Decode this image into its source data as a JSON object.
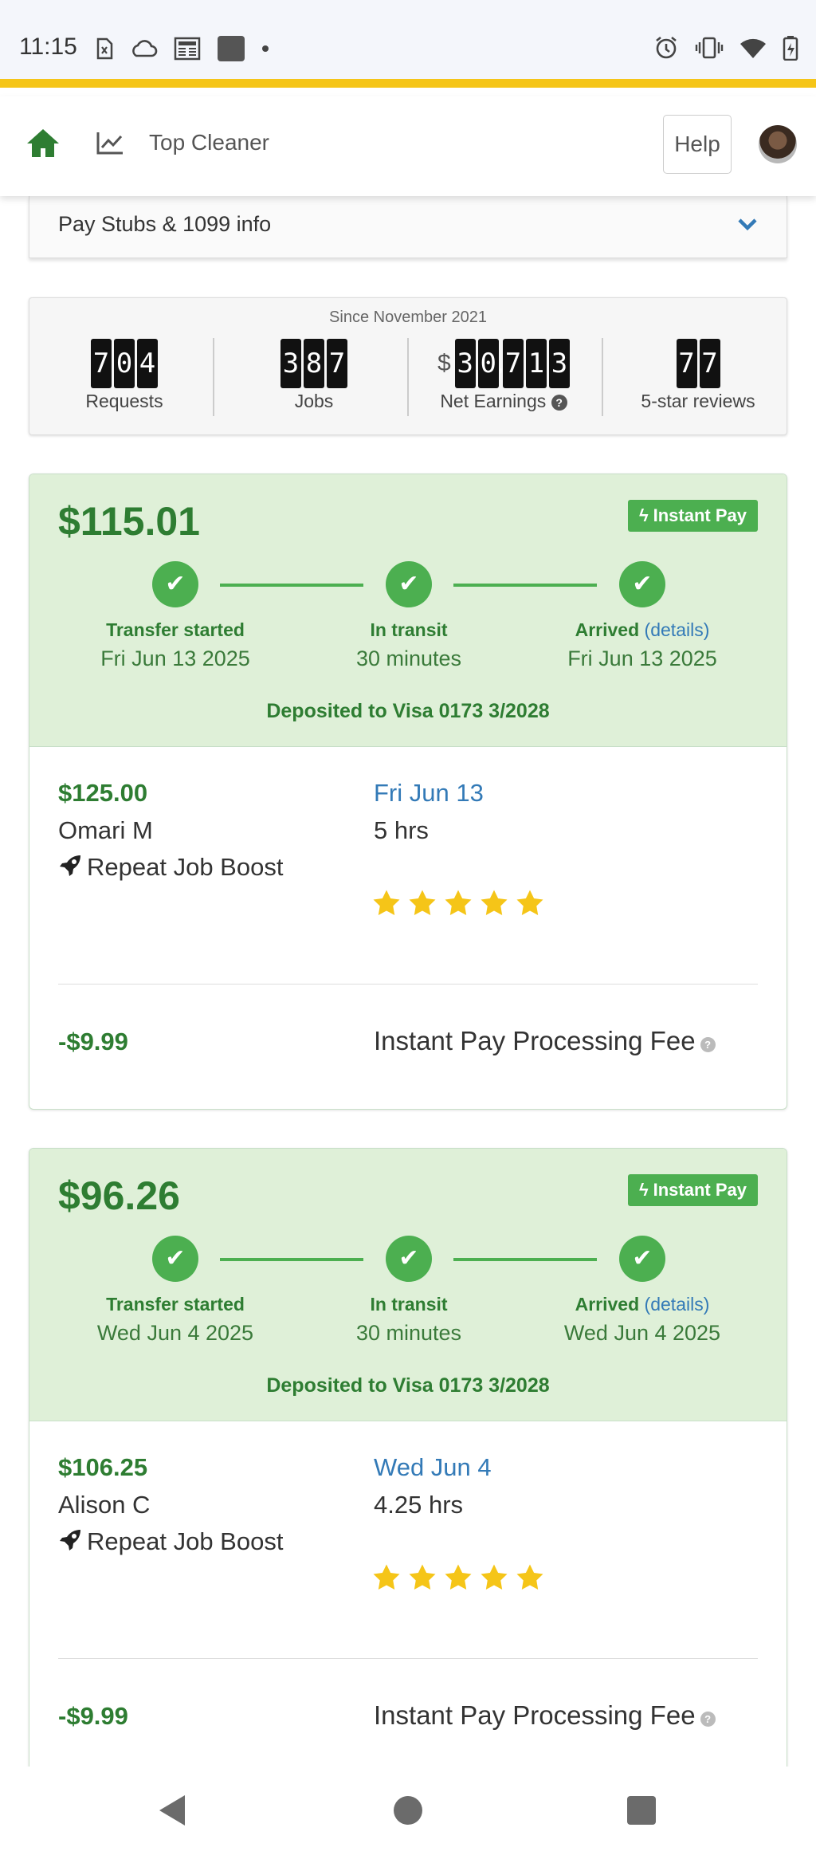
{
  "status_bar": {
    "time": "11:15",
    "left_icons": [
      "sim-icon",
      "cloud-icon",
      "newspaper-icon",
      "app-square-icon",
      "dot-icon"
    ],
    "right_icons": [
      "alarm-icon",
      "vibrate-icon",
      "wifi-icon",
      "battery-icon"
    ]
  },
  "header": {
    "title": "Top Cleaner",
    "help_label": "Help",
    "accent_color": "#f5c518",
    "home_color": "#2e7d32"
  },
  "pay_stubs": {
    "label": "Pay Stubs & 1099 info"
  },
  "stats": {
    "since": "Since November 2021",
    "items": [
      {
        "digits": [
          "7",
          "0",
          "4"
        ],
        "label": "Requests"
      },
      {
        "digits": [
          "3",
          "8",
          "7"
        ],
        "label": "Jobs"
      },
      {
        "prefix": "$",
        "digits": [
          "3",
          "0",
          ",",
          "7",
          "1",
          "3"
        ],
        "label": "Net Earnings"
      },
      {
        "digits": [
          "7",
          "7"
        ],
        "label": "5-star reviews"
      }
    ]
  },
  "payouts": [
    {
      "amount": "$115.01",
      "badge": "Instant Pay",
      "steps": [
        {
          "label": "Transfer started",
          "sub": "Fri Jun 13 2025"
        },
        {
          "label": "In transit",
          "sub": "30 minutes"
        },
        {
          "label": "Arrived",
          "link": "details",
          "sub": "Fri Jun 13 2025"
        }
      ],
      "deposit": "Deposited to Visa 0173 3/2028",
      "job": {
        "amount": "$125.00",
        "client": "Omari M",
        "boost": "Repeat Job Boost",
        "date": "Fri Jun 13",
        "hours": "5 hrs",
        "rating": 5
      },
      "fee": {
        "amount": "-$9.99",
        "label": "Instant Pay Processing Fee"
      }
    },
    {
      "amount": "$96.26",
      "badge": "Instant Pay",
      "steps": [
        {
          "label": "Transfer started",
          "sub": "Wed Jun 4 2025"
        },
        {
          "label": "In transit",
          "sub": "30 minutes"
        },
        {
          "label": "Arrived",
          "link": "details",
          "sub": "Wed Jun 4 2025"
        }
      ],
      "deposit": "Deposited to Visa 0173 3/2028",
      "job": {
        "amount": "$106.25",
        "client": "Alison C",
        "boost": "Repeat Job Boost",
        "date": "Wed Jun 4",
        "hours": "4.25 hrs",
        "rating": 5
      },
      "fee": {
        "amount": "-$9.99",
        "label": "Instant Pay Processing Fee"
      }
    }
  ],
  "nav": {
    "buttons": [
      "back-icon",
      "home-circle-icon",
      "recents-icon"
    ]
  }
}
